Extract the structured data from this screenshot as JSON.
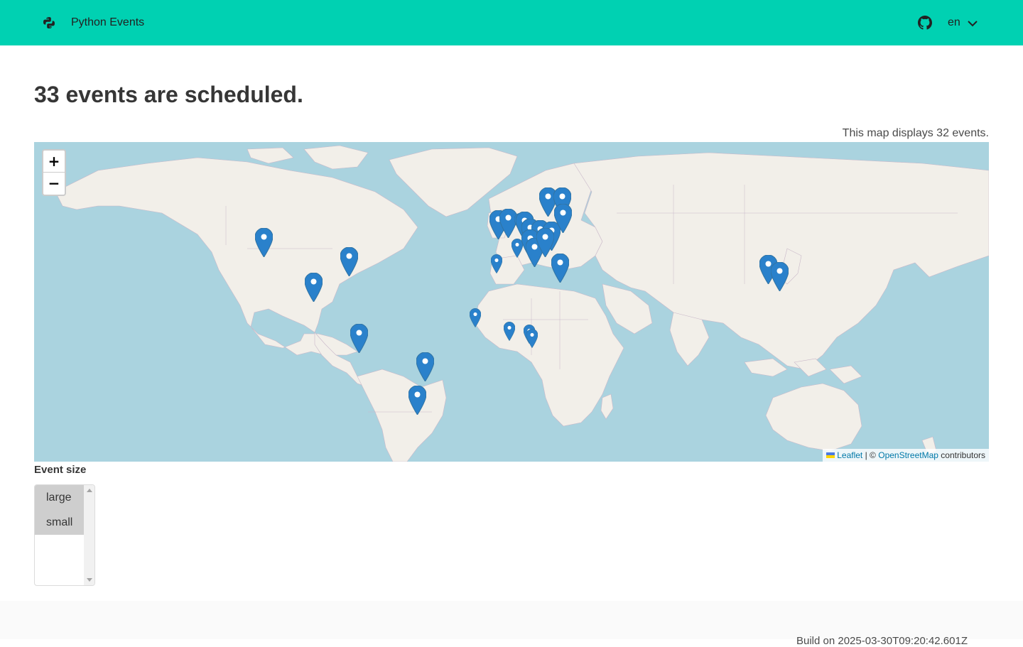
{
  "navbar": {
    "brand_icon": "python-icon",
    "brand_name": "Python Events",
    "github_icon": "github-icon",
    "language": "en",
    "language_chevron": "chevron-down-icon",
    "color": "#00d1b2"
  },
  "main": {
    "title": "33 events are scheduled.",
    "map_caption": "This map displays 32 events."
  },
  "map": {
    "zoom_in": "+",
    "zoom_out": "−",
    "attribution": {
      "leaflet": "Leaflet",
      "separator": "| ©",
      "osm": "OpenStreetMap",
      "suffix": "contributors"
    },
    "marker_icon": "map-pin-icon",
    "marker_color": "#2a81cb",
    "water_color": "#aad3df",
    "land_color": "#f2efe9"
  },
  "filter": {
    "label": "Event size",
    "options": [
      "large",
      "small"
    ]
  },
  "footer": {
    "text": "Build on 2025-03-30T09:20:42.601Z"
  }
}
